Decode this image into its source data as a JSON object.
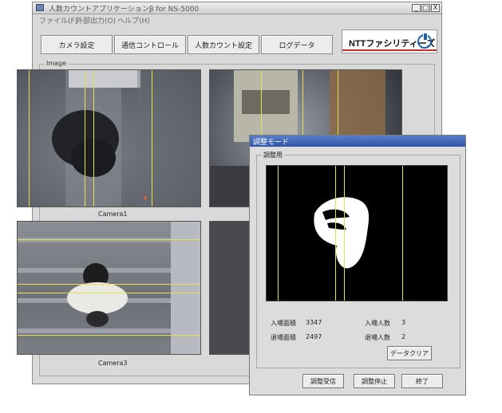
{
  "main_window": {
    "title": "人数カウントアプリケーションβ for NS-5000",
    "controls": {
      "minimize": "_",
      "maximize": "□",
      "close": "X"
    },
    "menu": [
      "ファイル(F)",
      "外部出力(O)",
      "ヘルプ(H)"
    ],
    "toolbar": [
      "カメラ設定",
      "通信コントロール",
      "人数カウント設定",
      "ログデータ"
    ],
    "logo": {
      "text": "NTTファシリティーズ",
      "icon": "power-icon",
      "accent": "#1f5fb0",
      "stripe": "#c9302c"
    }
  },
  "image_panel": {
    "label": "Image",
    "cameras": [
      {
        "label": "Camera1"
      },
      {
        "label": ""
      },
      {
        "label": "Camera3"
      },
      {
        "label": ""
      }
    ],
    "count_line_color": "#e8df4a"
  },
  "dialog": {
    "title": "調整モード",
    "group_label": "調整用",
    "stats": {
      "entry_area_label": "入場面積",
      "entry_area_value": "3347",
      "exit_area_label": "退場面積",
      "exit_area_value": "2497",
      "entry_count_label": "入場人数",
      "entry_count_value": "3",
      "exit_count_label": "退場人数",
      "exit_count_value": "2"
    },
    "buttons": {
      "clear": "データクリア",
      "receive": "調整受信",
      "stop": "調整停止",
      "exit": "終了"
    }
  }
}
